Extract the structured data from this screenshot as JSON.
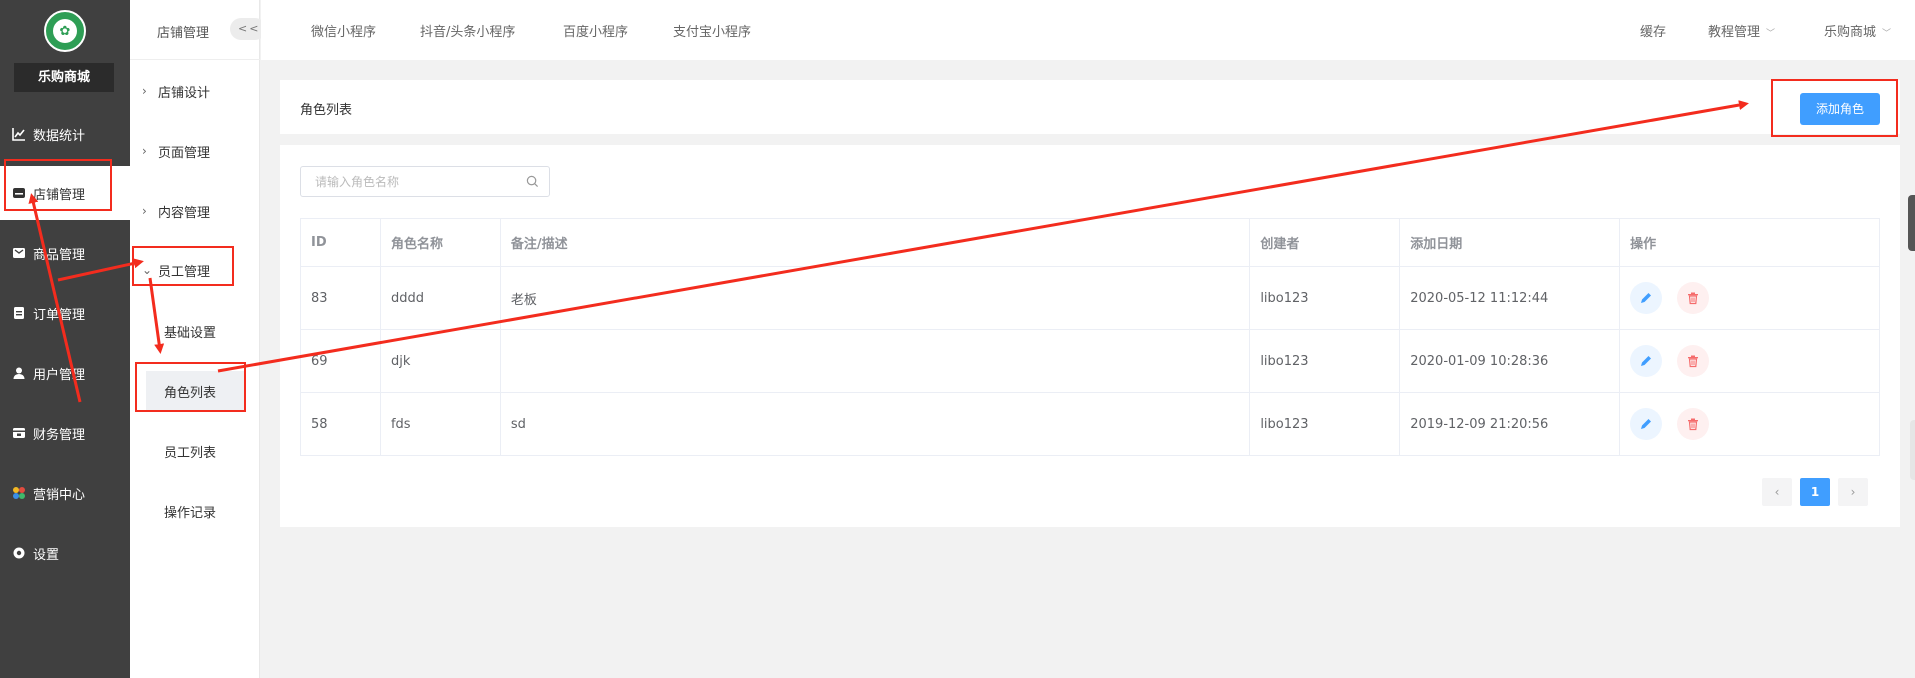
{
  "sidebar": {
    "shop_name": "乐购商城",
    "items": [
      {
        "label": "数据统计",
        "icon": "line-chart-icon"
      },
      {
        "label": "店铺管理",
        "icon": "store-icon"
      },
      {
        "label": "商品管理",
        "icon": "goods-icon"
      },
      {
        "label": "订单管理",
        "icon": "order-icon"
      },
      {
        "label": "用户管理",
        "icon": "user-icon"
      },
      {
        "label": "财务管理",
        "icon": "finance-icon"
      },
      {
        "label": "营销中心",
        "icon": "marketing-icon"
      },
      {
        "label": "设置",
        "icon": "settings-icon"
      }
    ]
  },
  "subnav": {
    "title": "店铺管理",
    "collapse_label": "<<",
    "items": [
      {
        "label": "店铺设计"
      },
      {
        "label": "页面管理"
      },
      {
        "label": "内容管理"
      },
      {
        "label": "员工管理"
      }
    ],
    "children": [
      {
        "label": "基础设置"
      },
      {
        "label": "角色列表"
      },
      {
        "label": "员工列表"
      },
      {
        "label": "操作记录"
      }
    ]
  },
  "topbar": {
    "links": [
      "微信小程序",
      "抖音/头条小程序",
      "百度小程序",
      "支付宝小程序"
    ],
    "cache": "缓存",
    "tutorial": "教程管理",
    "store": "乐购商城"
  },
  "page": {
    "title": "角色列表",
    "add_button": "添加角色"
  },
  "search": {
    "placeholder": "请输入角色名称",
    "value": ""
  },
  "table": {
    "headers": [
      "ID",
      "角色名称",
      "备注/描述",
      "创建者",
      "添加日期",
      "操作"
    ],
    "rows": [
      {
        "id": "83",
        "name": "dddd",
        "remark": "老板",
        "creator": "libo123",
        "date": "2020-05-12 11:12:44"
      },
      {
        "id": "69",
        "name": "djk",
        "remark": "",
        "creator": "libo123",
        "date": "2020-01-09 10:28:36"
      },
      {
        "id": "58",
        "name": "fds",
        "remark": "sd",
        "creator": "libo123",
        "date": "2019-12-09 21:20:56"
      }
    ]
  },
  "pagination": {
    "prev": "‹",
    "current": "1",
    "next": "›"
  },
  "colors": {
    "sidebar_bg": "#404040",
    "primary": "#409eff",
    "danger": "#f56c6c",
    "annotation": "#f32c1e",
    "logo_green": "#2e9e55"
  }
}
